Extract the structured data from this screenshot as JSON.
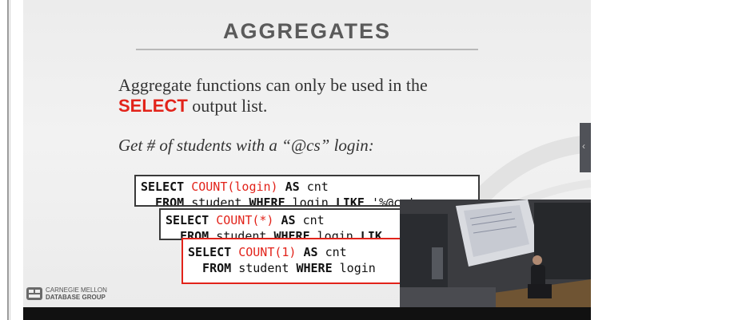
{
  "slide": {
    "title": "AGGREGATES",
    "body_line1": "Aggregate functions can only be used in the",
    "body_kw": "SELECT",
    "body_line2_rest": " output list.",
    "subtitle": "Get # of students with a “@cs” login:",
    "code1": {
      "l1_select": "SELECT ",
      "l1_func": "COUNT(login)",
      "l1_as": " AS",
      "l1_rest": " cnt",
      "l2_from": "  FROM",
      "l2_mid": " student ",
      "l2_where": "WHERE",
      "l2_mid2": " login ",
      "l2_like": "LIKE",
      "l2_rest": " '%@cs'"
    },
    "code2": {
      "l1_select": "SELECT ",
      "l1_func": "COUNT(*)",
      "l1_as": " AS",
      "l1_rest": " cnt",
      "l2_from": "  FROM",
      "l2_mid": " student ",
      "l2_where": "WHERE",
      "l2_mid2": " login ",
      "l2_like": "LIK"
    },
    "code3": {
      "l1_select": "SELECT ",
      "l1_func": "COUNT(1)",
      "l1_as": " AS",
      "l1_rest": " cnt",
      "l2_from": "  FROM",
      "l2_mid": " student ",
      "l2_where": "WHERE",
      "l2_rest": " login"
    },
    "logo_line1": "CARNEGIE MELLON",
    "logo_line2": "DATABASE GROUP"
  },
  "player": {
    "side_handle_icon": "chevron-left-icon"
  },
  "colors": {
    "accent_red": "#e2231a"
  }
}
